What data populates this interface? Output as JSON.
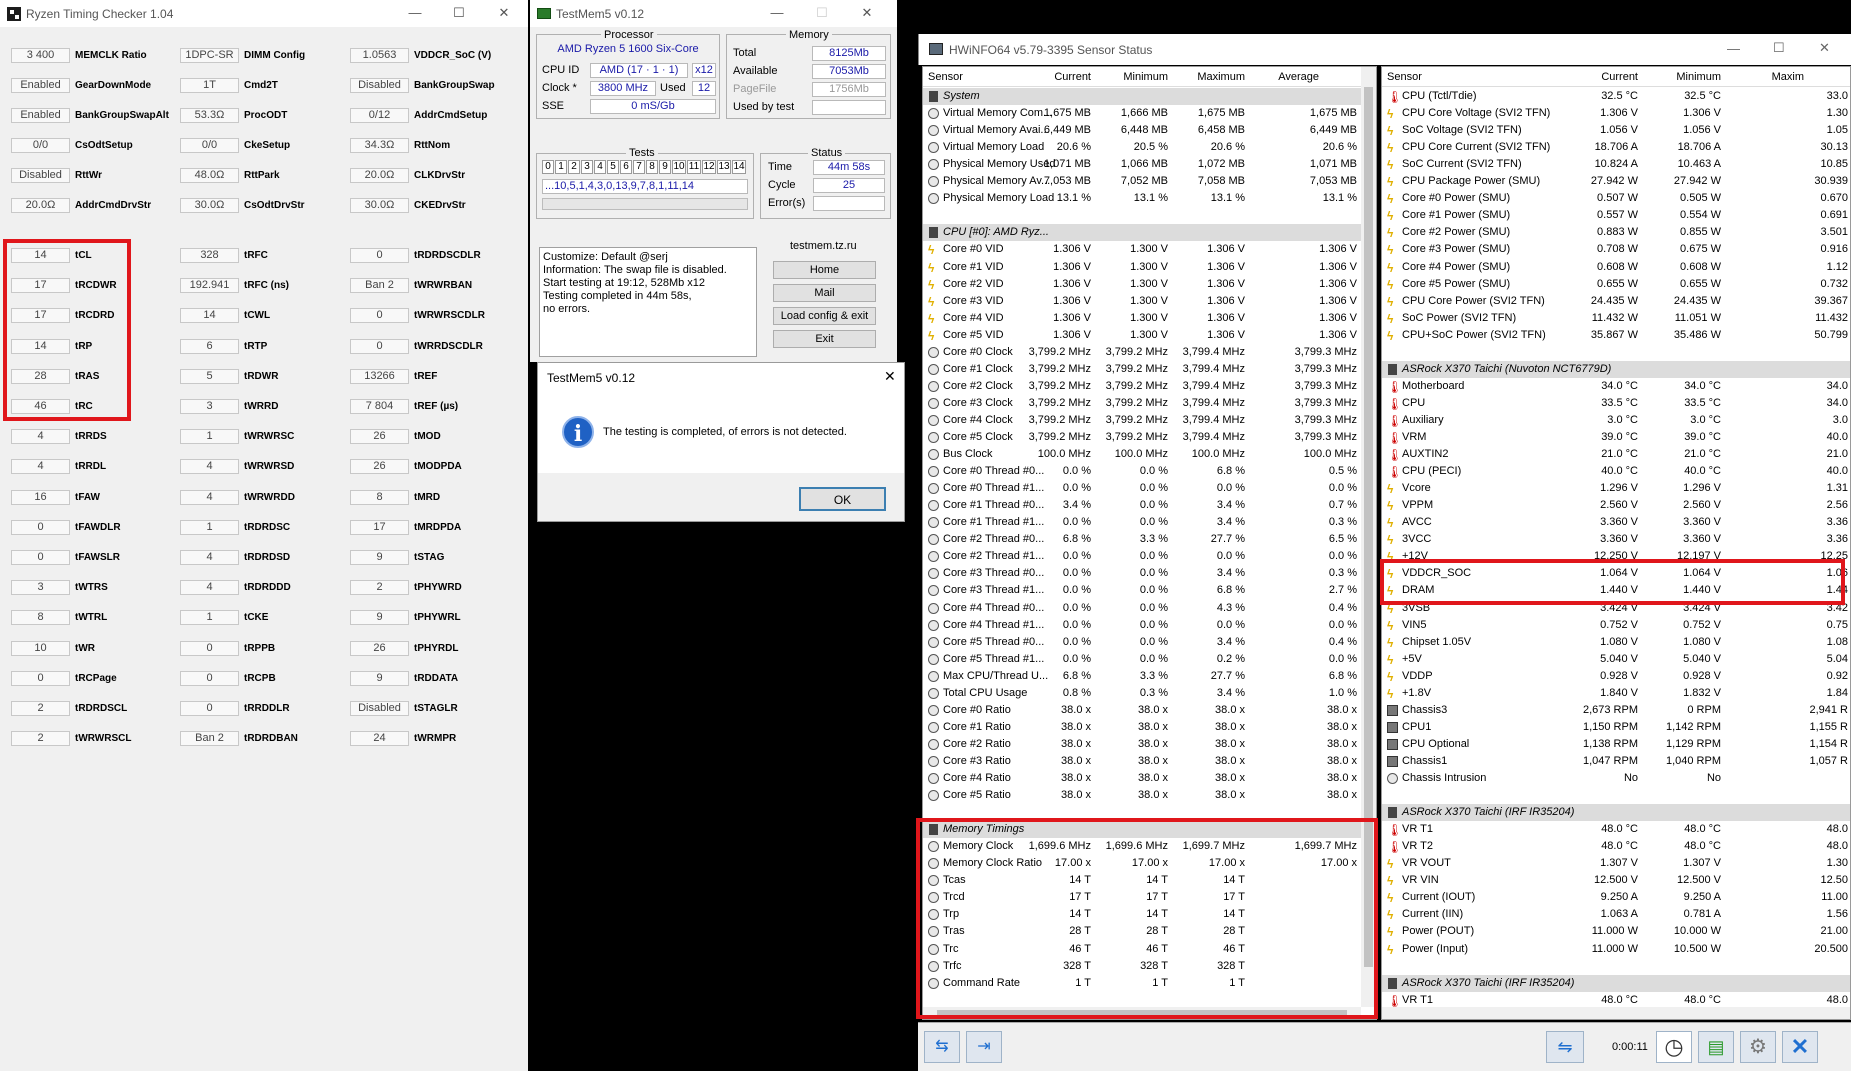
{
  "rtc": {
    "title": "Ryzen Timing Checker 1.04",
    "cols": [
      [
        [
          "3 400",
          "MEMCLK Ratio"
        ],
        [
          "Enabled",
          "GearDownMode"
        ],
        [
          "Enabled",
          "BankGroupSwapAlt"
        ],
        [
          "0/0",
          "CsOdtSetup"
        ],
        [
          "Disabled",
          "RttWr"
        ],
        [
          "20.0Ω",
          "AddrCmdDrvStr"
        ]
      ],
      [
        [
          "1DPC-SR",
          "DIMM Config"
        ],
        [
          "1T",
          "Cmd2T"
        ],
        [
          "53.3Ω",
          "ProcODT"
        ],
        [
          "0/0",
          "CkeSetup"
        ],
        [
          "48.0Ω",
          "RttPark"
        ],
        [
          "30.0Ω",
          "CsOdtDrvStr"
        ]
      ],
      [
        [
          "1.0563",
          "VDDCR_SoC (V)"
        ],
        [
          "Disabled",
          "BankGroupSwap"
        ],
        [
          "0/12",
          "AddrCmdSetup"
        ],
        [
          "34.3Ω",
          "RttNom"
        ],
        [
          "20.0Ω",
          "CLKDrvStr"
        ],
        [
          "30.0Ω",
          "CKEDrvStr"
        ]
      ]
    ],
    "tcols": [
      [
        [
          "14",
          "tCL"
        ],
        [
          "17",
          "tRCDWR"
        ],
        [
          "17",
          "tRCDRD"
        ],
        [
          "14",
          "tRP"
        ],
        [
          "28",
          "tRAS"
        ],
        [
          "46",
          "tRC"
        ],
        [
          "4",
          "tRRDS"
        ],
        [
          "4",
          "tRRDL"
        ],
        [
          "16",
          "tFAW"
        ],
        [
          "0",
          "tFAWDLR"
        ],
        [
          "0",
          "tFAWSLR"
        ],
        [
          "3",
          "tWTRS"
        ],
        [
          "8",
          "tWTRL"
        ],
        [
          "10",
          "tWR"
        ],
        [
          "0",
          "tRCPage"
        ],
        [
          "2",
          "tRDRDSCL"
        ],
        [
          "2",
          "tWRWRSCL"
        ]
      ],
      [
        [
          "328",
          "tRFC"
        ],
        [
          "192.941",
          "tRFC (ns)"
        ],
        [
          "14",
          "tCWL"
        ],
        [
          "6",
          "tRTP"
        ],
        [
          "5",
          "tRDWR"
        ],
        [
          "3",
          "tWRRD"
        ],
        [
          "1",
          "tWRWRSC"
        ],
        [
          "4",
          "tWRWRSD"
        ],
        [
          "4",
          "tWRWRDD"
        ],
        [
          "1",
          "tRDRDSC"
        ],
        [
          "4",
          "tRDRDSD"
        ],
        [
          "4",
          "tRDRDDD"
        ],
        [
          "1",
          "tCKE"
        ],
        [
          "0",
          "tRPPB"
        ],
        [
          "0",
          "tRCPB"
        ],
        [
          "0",
          "tRRDDLR"
        ],
        [
          "Ban 2",
          "tRDRDBAN"
        ]
      ],
      [
        [
          "0",
          "tRDRDSCDLR"
        ],
        [
          "Ban 2",
          "tWRWRBAN"
        ],
        [
          "0",
          "tWRWRSCDLR"
        ],
        [
          "0",
          "tWRRDSCDLR"
        ],
        [
          "13266",
          "tREF"
        ],
        [
          "7 804",
          "tREF (µs)"
        ],
        [
          "26",
          "tMOD"
        ],
        [
          "26",
          "tMODPDA"
        ],
        [
          "8",
          "tMRD"
        ],
        [
          "17",
          "tMRDPDA"
        ],
        [
          "9",
          "tSTAG"
        ],
        [
          "2",
          "tPHYWRD"
        ],
        [
          "9",
          "tPHYWRL"
        ],
        [
          "26",
          "tPHYRDL"
        ],
        [
          "9",
          "tRDDATA"
        ],
        [
          "Disabled",
          "tSTAGLR"
        ],
        [
          "24",
          "tWRMPR"
        ]
      ]
    ]
  },
  "tm": {
    "title": "TestMem5 v0.12",
    "processor_hdr": "Processor",
    "proc_name": "AMD Ryzen 5 1600 Six-Core",
    "cpuid_lab": "CPU ID",
    "cpuid": "AMD  (17 · 1 · 1)",
    "x12": "x12",
    "clock_lab": "Clock *",
    "clock": "3800 MHz",
    "used_lab": "Used",
    "used": "12",
    "sse_lab": "SSE",
    "sse": "0 mS/Gb",
    "memory_hdr": "Memory",
    "total_lab": "Total",
    "total": "8125Mb",
    "avail_lab": "Available",
    "avail": "7053Mb",
    "pagefile_lab": "PageFile",
    "pagefile": "1756Mb",
    "usedby_lab": "Used by test",
    "usedby": "",
    "tests_hdr": "Tests",
    "test_nums": [
      "0",
      "1",
      "2",
      "3",
      "4",
      "5",
      "6",
      "7",
      "8",
      "9",
      "10",
      "11",
      "12",
      "13",
      "14"
    ],
    "test_seq": "...10,5,1,4,3,0,13,9,7,8,1,11,14",
    "status_hdr": "Status",
    "time_lab": "Time",
    "time": "44m 58s",
    "cycle_lab": "Cycle",
    "cycle": "25",
    "errors_lab": "Error(s)",
    "errors": "",
    "log": [
      "Customize: Default @serj",
      "Information: The swap file is disabled.",
      "Start testing at 19:12, 528Mb x12",
      "Testing completed in 44m 58s,",
      "no errors."
    ],
    "site": "testmem.tz.ru",
    "buttons": [
      "Home",
      "Mail",
      "Load config & exit",
      "Exit"
    ],
    "dlg_title": "TestMem5 v0.12",
    "dlg_msg": "The testing is completed, of errors is not detected.",
    "dlg_ok": "OK"
  },
  "hw": {
    "title": "HWiNFO64 v5.79-3395 Sensor Status",
    "time": "0:00:11",
    "lhead": [
      "Sensor",
      "Current",
      "Minimum",
      "Maximum",
      "Average"
    ],
    "rhead": [
      "Sensor",
      "Current",
      "Minimum",
      "Maxim"
    ],
    "left": [
      [
        "g",
        "System"
      ],
      [
        "c",
        "Virtual Memory Com...",
        "1,675 MB",
        "1,666 MB",
        "1,675 MB",
        "1,675 MB"
      ],
      [
        "c",
        "Virtual Memory Avai...",
        "6,449 MB",
        "6,448 MB",
        "6,458 MB",
        "6,449 MB"
      ],
      [
        "c",
        "Virtual Memory Load",
        "20.6 %",
        "20.5 %",
        "20.6 %",
        "20.6 %"
      ],
      [
        "c",
        "Physical Memory Used",
        "1,071 MB",
        "1,066 MB",
        "1,072 MB",
        "1,071 MB"
      ],
      [
        "c",
        "Physical Memory Av...",
        "7,053 MB",
        "7,052 MB",
        "7,058 MB",
        "7,053 MB"
      ],
      [
        "c",
        "Physical Memory Load",
        "13.1 %",
        "13.1 %",
        "13.1 %",
        "13.1 %"
      ],
      [
        "e"
      ],
      [
        "g",
        "CPU [#0]: AMD Ryz..."
      ],
      [
        "b",
        "Core #0 VID",
        "1.306 V",
        "1.300 V",
        "1.306 V",
        "1.306 V"
      ],
      [
        "b",
        "Core #1 VID",
        "1.306 V",
        "1.300 V",
        "1.306 V",
        "1.306 V"
      ],
      [
        "b",
        "Core #2 VID",
        "1.306 V",
        "1.300 V",
        "1.306 V",
        "1.306 V"
      ],
      [
        "b",
        "Core #3 VID",
        "1.306 V",
        "1.300 V",
        "1.306 V",
        "1.306 V"
      ],
      [
        "b",
        "Core #4 VID",
        "1.306 V",
        "1.300 V",
        "1.306 V",
        "1.306 V"
      ],
      [
        "b",
        "Core #5 VID",
        "1.306 V",
        "1.300 V",
        "1.306 V",
        "1.306 V"
      ],
      [
        "c",
        "Core #0 Clock",
        "3,799.2 MHz",
        "3,799.2 MHz",
        "3,799.4 MHz",
        "3,799.3 MHz"
      ],
      [
        "c",
        "Core #1 Clock",
        "3,799.2 MHz",
        "3,799.2 MHz",
        "3,799.4 MHz",
        "3,799.3 MHz"
      ],
      [
        "c",
        "Core #2 Clock",
        "3,799.2 MHz",
        "3,799.2 MHz",
        "3,799.4 MHz",
        "3,799.3 MHz"
      ],
      [
        "c",
        "Core #3 Clock",
        "3,799.2 MHz",
        "3,799.2 MHz",
        "3,799.4 MHz",
        "3,799.3 MHz"
      ],
      [
        "c",
        "Core #4 Clock",
        "3,799.2 MHz",
        "3,799.2 MHz",
        "3,799.4 MHz",
        "3,799.3 MHz"
      ],
      [
        "c",
        "Core #5 Clock",
        "3,799.2 MHz",
        "3,799.2 MHz",
        "3,799.4 MHz",
        "3,799.3 MHz"
      ],
      [
        "c",
        "Bus Clock",
        "100.0 MHz",
        "100.0 MHz",
        "100.0 MHz",
        "100.0 MHz"
      ],
      [
        "c",
        "Core #0 Thread #0...",
        "0.0 %",
        "0.0 %",
        "6.8 %",
        "0.5 %"
      ],
      [
        "c",
        "Core #0 Thread #1...",
        "0.0 %",
        "0.0 %",
        "0.0 %",
        "0.0 %"
      ],
      [
        "c",
        "Core #1 Thread #0...",
        "3.4 %",
        "0.0 %",
        "3.4 %",
        "0.7 %"
      ],
      [
        "c",
        "Core #1 Thread #1...",
        "0.0 %",
        "0.0 %",
        "3.4 %",
        "0.3 %"
      ],
      [
        "c",
        "Core #2 Thread #0...",
        "6.8 %",
        "3.3 %",
        "27.7 %",
        "6.5 %"
      ],
      [
        "c",
        "Core #2 Thread #1...",
        "0.0 %",
        "0.0 %",
        "0.0 %",
        "0.0 %"
      ],
      [
        "c",
        "Core #3 Thread #0...",
        "0.0 %",
        "0.0 %",
        "3.4 %",
        "0.3 %"
      ],
      [
        "c",
        "Core #3 Thread #1...",
        "0.0 %",
        "0.0 %",
        "6.8 %",
        "2.7 %"
      ],
      [
        "c",
        "Core #4 Thread #0...",
        "0.0 %",
        "0.0 %",
        "4.3 %",
        "0.4 %"
      ],
      [
        "c",
        "Core #4 Thread #1...",
        "0.0 %",
        "0.0 %",
        "0.0 %",
        "0.0 %"
      ],
      [
        "c",
        "Core #5 Thread #0...",
        "0.0 %",
        "0.0 %",
        "3.4 %",
        "0.4 %"
      ],
      [
        "c",
        "Core #5 Thread #1...",
        "0.0 %",
        "0.0 %",
        "0.2 %",
        "0.0 %"
      ],
      [
        "c",
        "Max CPU/Thread U...",
        "6.8 %",
        "3.3 %",
        "27.7 %",
        "6.8 %"
      ],
      [
        "c",
        "Total CPU Usage",
        "0.8 %",
        "0.3 %",
        "3.4 %",
        "1.0 %"
      ],
      [
        "c",
        "Core #0 Ratio",
        "38.0 x",
        "38.0 x",
        "38.0 x",
        "38.0 x"
      ],
      [
        "c",
        "Core #1 Ratio",
        "38.0 x",
        "38.0 x",
        "38.0 x",
        "38.0 x"
      ],
      [
        "c",
        "Core #2 Ratio",
        "38.0 x",
        "38.0 x",
        "38.0 x",
        "38.0 x"
      ],
      [
        "c",
        "Core #3 Ratio",
        "38.0 x",
        "38.0 x",
        "38.0 x",
        "38.0 x"
      ],
      [
        "c",
        "Core #4 Ratio",
        "38.0 x",
        "38.0 x",
        "38.0 x",
        "38.0 x"
      ],
      [
        "c",
        "Core #5 Ratio",
        "38.0 x",
        "38.0 x",
        "38.0 x",
        "38.0 x"
      ],
      [
        "e"
      ],
      [
        "g",
        "Memory Timings"
      ],
      [
        "c",
        "Memory Clock",
        "1,699.6 MHz",
        "1,699.6 MHz",
        "1,699.7 MHz",
        "1,699.7 MHz"
      ],
      [
        "c",
        "Memory Clock Ratio",
        "17.00 x",
        "17.00 x",
        "17.00 x",
        "17.00 x"
      ],
      [
        "c",
        "Tcas",
        "14 T",
        "14 T",
        "14 T",
        ""
      ],
      [
        "c",
        "Trcd",
        "17 T",
        "17 T",
        "17 T",
        ""
      ],
      [
        "c",
        "Trp",
        "14 T",
        "14 T",
        "14 T",
        ""
      ],
      [
        "c",
        "Tras",
        "28 T",
        "28 T",
        "28 T",
        ""
      ],
      [
        "c",
        "Trc",
        "46 T",
        "46 T",
        "46 T",
        ""
      ],
      [
        "c",
        "Trfc",
        "328 T",
        "328 T",
        "328 T",
        ""
      ],
      [
        "c",
        "Command Rate",
        "1 T",
        "1 T",
        "1 T",
        ""
      ]
    ],
    "right": [
      [
        "t",
        "CPU (Tctl/Tdie)",
        "32.5 °C",
        "32.5 °C",
        "33.0"
      ],
      [
        "b",
        "CPU Core Voltage (SVI2 TFN)",
        "1.306 V",
        "1.306 V",
        "1.30"
      ],
      [
        "b",
        "SoC Voltage (SVI2 TFN)",
        "1.056 V",
        "1.056 V",
        "1.05"
      ],
      [
        "b",
        "CPU Core Current (SVI2 TFN)",
        "18.706 A",
        "18.706 A",
        "30.13"
      ],
      [
        "b",
        "SoC Current (SVI2 TFN)",
        "10.824 A",
        "10.463 A",
        "10.85"
      ],
      [
        "b",
        "CPU Package Power (SMU)",
        "27.942 W",
        "27.942 W",
        "30.939"
      ],
      [
        "b",
        "Core #0 Power (SMU)",
        "0.507 W",
        "0.505 W",
        "0.670"
      ],
      [
        "b",
        "Core #1 Power (SMU)",
        "0.557 W",
        "0.554 W",
        "0.691"
      ],
      [
        "b",
        "Core #2 Power (SMU)",
        "0.883 W",
        "0.855 W",
        "3.501"
      ],
      [
        "b",
        "Core #3 Power (SMU)",
        "0.708 W",
        "0.675 W",
        "0.916"
      ],
      [
        "b",
        "Core #4 Power (SMU)",
        "0.608 W",
        "0.608 W",
        "1.12"
      ],
      [
        "b",
        "Core #5 Power (SMU)",
        "0.655 W",
        "0.655 W",
        "0.732"
      ],
      [
        "b",
        "CPU Core Power (SVI2 TFN)",
        "24.435 W",
        "24.435 W",
        "39.367"
      ],
      [
        "b",
        "SoC Power (SVI2 TFN)",
        "11.432 W",
        "11.051 W",
        "11.432"
      ],
      [
        "b",
        "CPU+SoC Power (SVI2 TFN)",
        "35.867 W",
        "35.486 W",
        "50.799"
      ],
      [
        "e"
      ],
      [
        "g",
        "ASRock X370 Taichi (Nuvoton NCT6779D)"
      ],
      [
        "t",
        "Motherboard",
        "34.0 °C",
        "34.0 °C",
        "34.0"
      ],
      [
        "t",
        "CPU",
        "33.5 °C",
        "33.5 °C",
        "34.0"
      ],
      [
        "t",
        "Auxiliary",
        "3.0 °C",
        "3.0 °C",
        "3.0"
      ],
      [
        "t",
        "VRM",
        "39.0 °C",
        "39.0 °C",
        "40.0"
      ],
      [
        "t",
        "AUXTIN2",
        "21.0 °C",
        "21.0 °C",
        "21.0"
      ],
      [
        "t",
        "CPU (PECI)",
        "40.0 °C",
        "40.0 °C",
        "40.0"
      ],
      [
        "b",
        "Vcore",
        "1.296 V",
        "1.296 V",
        "1.31"
      ],
      [
        "b",
        "VPPM",
        "2.560 V",
        "2.560 V",
        "2.56"
      ],
      [
        "b",
        "AVCC",
        "3.360 V",
        "3.360 V",
        "3.36"
      ],
      [
        "b",
        "3VCC",
        "3.360 V",
        "3.360 V",
        "3.36"
      ],
      [
        "b",
        "+12V",
        "12.250 V",
        "12.197 V",
        "12.25"
      ],
      [
        "b",
        "VDDCR_SOC",
        "1.064 V",
        "1.064 V",
        "1.06"
      ],
      [
        "b",
        "DRAM",
        "1.440 V",
        "1.440 V",
        "1.44"
      ],
      [
        "b",
        "3VSB",
        "3.424 V",
        "3.424 V",
        "3.42"
      ],
      [
        "b",
        "VIN5",
        "0.752 V",
        "0.752 V",
        "0.75"
      ],
      [
        "b",
        "Chipset 1.05V",
        "1.080 V",
        "1.080 V",
        "1.08"
      ],
      [
        "b",
        "+5V",
        "5.040 V",
        "5.040 V",
        "5.04"
      ],
      [
        "b",
        "VDDP",
        "0.928 V",
        "0.928 V",
        "0.92"
      ],
      [
        "b",
        "+1.8V",
        "1.840 V",
        "1.832 V",
        "1.84"
      ],
      [
        "f",
        "Chassis3",
        "2,673 RPM",
        "0 RPM",
        "2,941 R"
      ],
      [
        "f",
        "CPU1",
        "1,150 RPM",
        "1,142 RPM",
        "1,155 R"
      ],
      [
        "f",
        "CPU Optional",
        "1,138 RPM",
        "1,129 RPM",
        "1,154 R"
      ],
      [
        "f",
        "Chassis1",
        "1,047 RPM",
        "1,040 RPM",
        "1,057 R"
      ],
      [
        "c",
        "Chassis Intrusion",
        "No",
        "No",
        ""
      ],
      [
        "e"
      ],
      [
        "g",
        "ASRock X370 Taichi (IRF IR35204)"
      ],
      [
        "t",
        "VR T1",
        "48.0 °C",
        "48.0 °C",
        "48.0"
      ],
      [
        "t",
        "VR T2",
        "48.0 °C",
        "48.0 °C",
        "48.0"
      ],
      [
        "b",
        "VR VOUT",
        "1.307 V",
        "1.307 V",
        "1.30"
      ],
      [
        "b",
        "VR VIN",
        "12.500 V",
        "12.500 V",
        "12.50"
      ],
      [
        "b",
        "Current (IOUT)",
        "9.250 A",
        "9.250 A",
        "11.00"
      ],
      [
        "b",
        "Current (IIN)",
        "1.063 A",
        "0.781 A",
        "1.56"
      ],
      [
        "b",
        "Power (POUT)",
        "11.000 W",
        "10.000 W",
        "21.00"
      ],
      [
        "b",
        "Power (Input)",
        "11.000 W",
        "10.500 W",
        "20.500"
      ],
      [
        "e"
      ],
      [
        "g",
        "ASRock X370 Taichi (IRF IR35204)"
      ],
      [
        "t",
        "VR T1",
        "48.0 °C",
        "48.0 °C",
        "48.0"
      ]
    ]
  }
}
